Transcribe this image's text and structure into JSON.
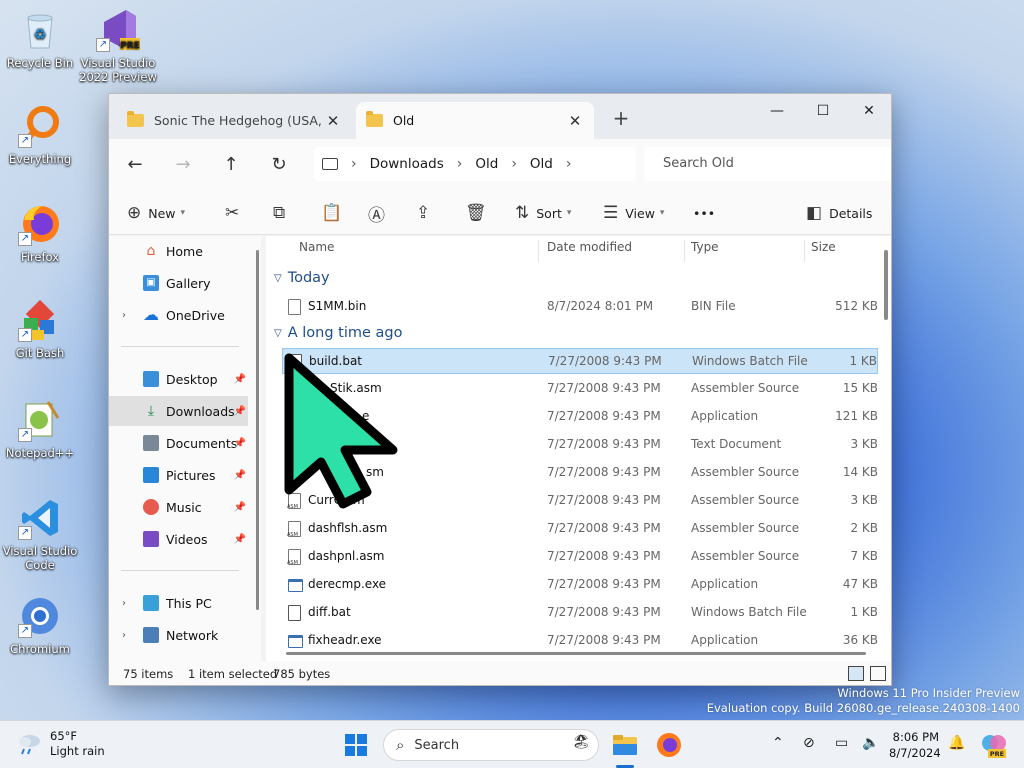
{
  "desktop": {
    "icons": [
      {
        "label": "Recycle Bin"
      },
      {
        "label": "Visual Studio 2022 Preview",
        "badge": "PRE"
      },
      {
        "label": "Everything"
      },
      {
        "label": "Firefox"
      },
      {
        "label": "Git Bash"
      },
      {
        "label": "Notepad++"
      },
      {
        "label": "Visual Studio Code"
      },
      {
        "label": "Chromium"
      }
    ],
    "watermark": {
      "line1": "Windows 11 Pro Insider Preview",
      "line2": "Evaluation copy. Build 26080.ge_release.240308-1400"
    }
  },
  "window": {
    "tabs": [
      {
        "label": "Sonic The Hedgehog (USA, Europe)",
        "active": false
      },
      {
        "label": "Old",
        "active": true
      }
    ],
    "controls": {
      "minimize": "—",
      "maximize": "☐",
      "close": "✕"
    },
    "breadcrumb": [
      "Downloads",
      "Old",
      "Old"
    ],
    "search_placeholder": "Search Old",
    "commands": {
      "new": "New",
      "sort": "Sort",
      "view": "View",
      "more": "•••",
      "details": "Details"
    },
    "nav": {
      "quick": [
        {
          "label": "Home"
        },
        {
          "label": "Gallery"
        },
        {
          "label": "OneDrive"
        }
      ],
      "pinned": [
        {
          "label": "Desktop"
        },
        {
          "label": "Downloads"
        },
        {
          "label": "Documents"
        },
        {
          "label": "Pictures"
        },
        {
          "label": "Music"
        },
        {
          "label": "Videos"
        }
      ],
      "devices": [
        {
          "label": "This PC"
        },
        {
          "label": "Network"
        }
      ]
    },
    "columns": {
      "name": "Name",
      "date": "Date modified",
      "type": "Type",
      "size": "Size"
    },
    "groups": {
      "today": "Today",
      "old": "A long time ago"
    },
    "files_today": [
      {
        "name": "S1MM.bin",
        "date": "8/7/2024 8:01 PM",
        "type": "BIN File",
        "size": "512 KB"
      }
    ],
    "files_old": [
      {
        "name": "build.bat",
        "date": "7/27/2008 9:43 PM",
        "type": "Windows Batch File",
        "size": "1 KB",
        "selected": true
      },
      {
        "name": "Stik.asm",
        "date": "7/27/2008 9:43 PM",
        "type": "Assembler Source",
        "size": "15 KB"
      },
      {
        "name": "e",
        "date": "7/27/2008 9:43 PM",
        "type": "Application",
        "size": "121 KB"
      },
      {
        "name": "",
        "date": "7/27/2008 9:43 PM",
        "type": "Text Document",
        "size": "3 KB"
      },
      {
        "name": "sm",
        "date": "7/27/2008 9:43 PM",
        "type": "Assembler Source",
        "size": "14 KB"
      },
      {
        "name": "CurrG.sm",
        "date": "7/27/2008 9:43 PM",
        "type": "Assembler Source",
        "size": "3 KB"
      },
      {
        "name": "dashflsh.asm",
        "date": "7/27/2008 9:43 PM",
        "type": "Assembler Source",
        "size": "2 KB"
      },
      {
        "name": "dashpnl.asm",
        "date": "7/27/2008 9:43 PM",
        "type": "Assembler Source",
        "size": "7 KB"
      },
      {
        "name": "derecmp.exe",
        "date": "7/27/2008 9:43 PM",
        "type": "Application",
        "size": "47 KB"
      },
      {
        "name": "diff.bat",
        "date": "7/27/2008 9:43 PM",
        "type": "Windows Batch File",
        "size": "1 KB"
      },
      {
        "name": "fixheadr.exe",
        "date": "7/27/2008 9:43 PM",
        "type": "Application",
        "size": "36 KB"
      }
    ],
    "status": {
      "items": "75 items",
      "selected": "1 item selected",
      "bytes": "785 bytes"
    }
  },
  "taskbar": {
    "weather_temp": "65°F",
    "weather_desc": "Light rain",
    "search": "Search",
    "time": "8:06 PM",
    "date": "8/7/2024",
    "copilot_badge": "PRE"
  }
}
